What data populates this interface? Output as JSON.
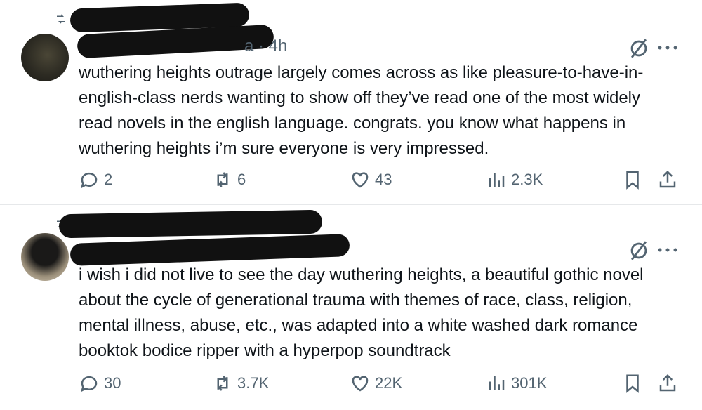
{
  "tweets": [
    {
      "handle_suffix": "a · 4h",
      "text": "wuthering heights outrage largely comes across as like pleasure-to-have-in-english-class nerds wanting to show off they’ve read one of the most widely read novels in the english language. congrats. you know what happens in wuthering heights i’m sure everyone is very impressed.",
      "replies": "2",
      "reposts": "6",
      "likes": "43",
      "views": "2.3K"
    },
    {
      "handle_suffix": "",
      "text": "i wish i did not live to see the day wuthering heights, a beautiful gothic novel about the cycle of generational trauma with themes of race, class, religion, mental illness, abuse, etc., was adapted into a white washed dark romance booktok bodice ripper with a hyperpop soundtrack",
      "replies": "30",
      "reposts": "3.7K",
      "likes": "22K",
      "views": "301K"
    }
  ],
  "icons": [
    "retweet-icon",
    "grok-icon",
    "more-icon",
    "reply-icon",
    "repost-icon",
    "like-icon",
    "views-icon",
    "bookmark-icon",
    "share-icon"
  ]
}
